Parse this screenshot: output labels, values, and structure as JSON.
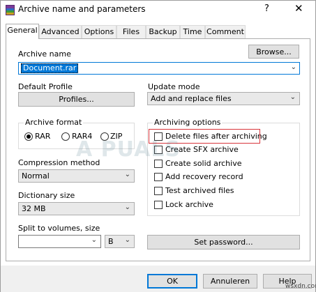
{
  "window": {
    "title": "Archive name and parameters",
    "help_glyph": "?",
    "close_glyph": "✕"
  },
  "tabs": [
    {
      "label": "General",
      "active": true
    },
    {
      "label": "Advanced"
    },
    {
      "label": "Options"
    },
    {
      "label": "Files"
    },
    {
      "label": "Backup"
    },
    {
      "label": "Time"
    },
    {
      "label": "Comment"
    }
  ],
  "archive_name": {
    "label": "Archive name",
    "value": "Document.rar",
    "browse_label": "Browse..."
  },
  "default_profile": {
    "label": "Default Profile",
    "button_label": "Profiles..."
  },
  "update_mode": {
    "label": "Update mode",
    "value": "Add and replace files"
  },
  "archive_format": {
    "title": "Archive format",
    "options": [
      {
        "label": "RAR",
        "selected": true
      },
      {
        "label": "RAR4",
        "selected": false
      },
      {
        "label": "ZIP",
        "selected": false
      }
    ]
  },
  "compression_method": {
    "label": "Compression method",
    "value": "Normal"
  },
  "dictionary_size": {
    "label": "Dictionary size",
    "value": "32 MB"
  },
  "split_volumes": {
    "label": "Split to volumes, size",
    "value": "",
    "unit": "B"
  },
  "archiving_options": {
    "title": "Archiving options",
    "items": [
      {
        "label": "Delete files after archiving",
        "checked": false,
        "highlighted": true
      },
      {
        "label": "Create SFX archive",
        "checked": false
      },
      {
        "label": "Create solid archive",
        "checked": false
      },
      {
        "label": "Add recovery record",
        "checked": false
      },
      {
        "label": "Test archived files",
        "checked": false
      },
      {
        "label": "Lock archive",
        "checked": false
      }
    ]
  },
  "set_password_label": "Set password...",
  "footer": {
    "ok_label": "OK",
    "cancel_label": "Annuleren",
    "help_label": "Help"
  },
  "watermark_text": "A   PUALS",
  "site_mark": "wsxdn.com",
  "colors": {
    "accent": "#0078d7",
    "highlight_box": "#d8343a"
  },
  "icons": {
    "app": "winrar-icon",
    "dropdown": "chevron-down-icon",
    "close": "close-icon",
    "help": "help-icon"
  }
}
